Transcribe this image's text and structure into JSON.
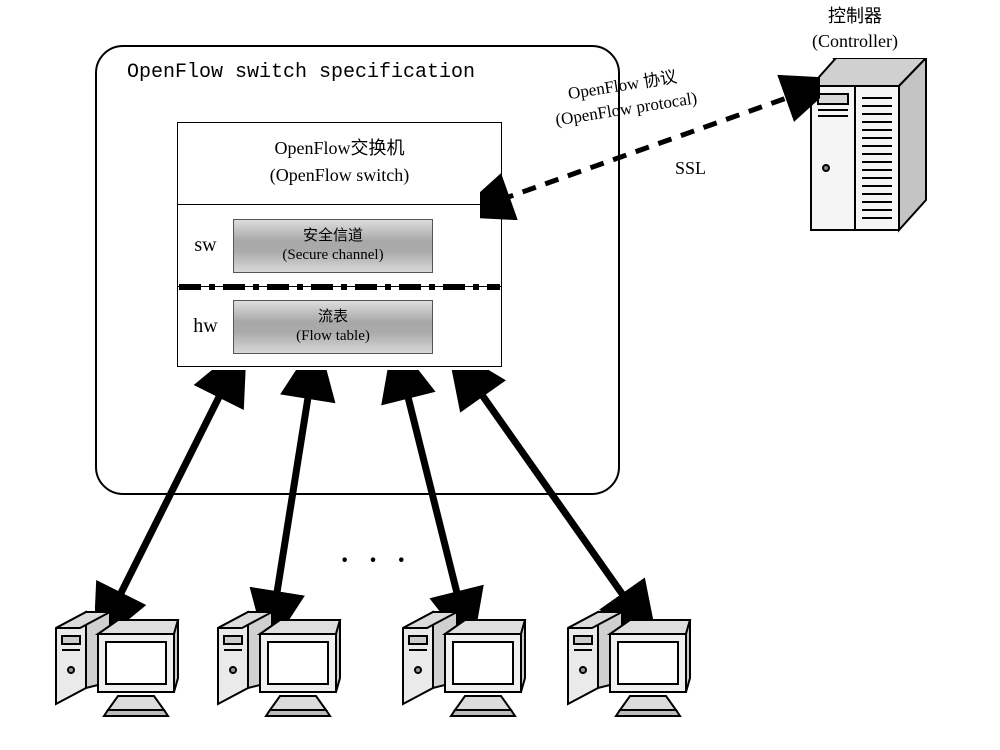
{
  "controller": {
    "label_cn": "控制器",
    "label_en": "(Controller)"
  },
  "spec": {
    "title": "OpenFlow switch specification"
  },
  "switch": {
    "title_cn": "OpenFlow交换机",
    "title_en": "(OpenFlow switch)",
    "sw_label": "sw",
    "hw_label": "hw",
    "secure_cn": "安全信道",
    "secure_en": "(Secure channel)",
    "flow_cn": "流表",
    "flow_en": "(Flow table)"
  },
  "protocol": {
    "line1": "OpenFlow 协议",
    "line2": "(OpenFlow protocal)"
  },
  "ssl": "SSL",
  "ellipsis": "· · ·"
}
